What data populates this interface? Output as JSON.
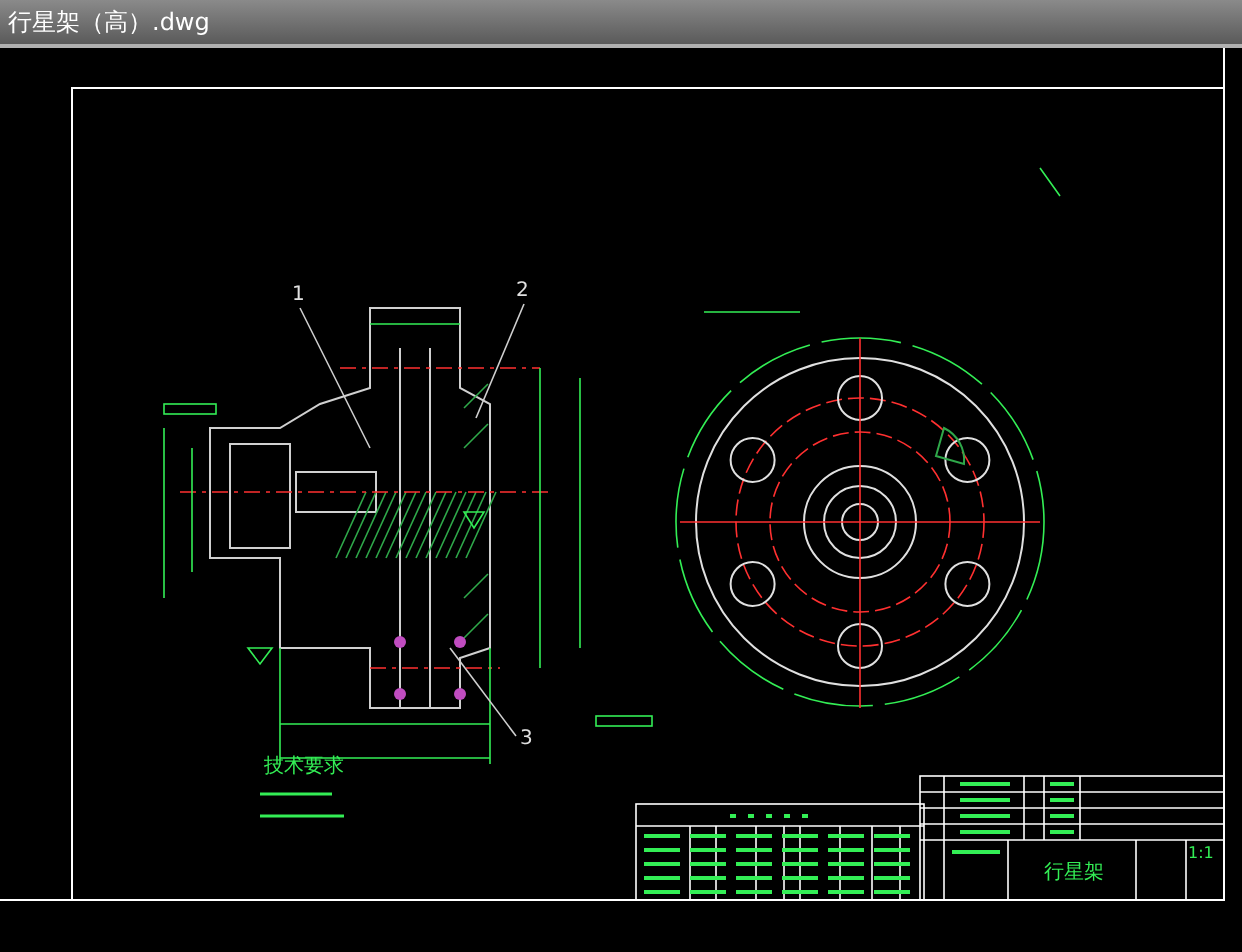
{
  "window": {
    "title": "行星架（高）.dwg"
  },
  "drawing": {
    "part_labels": [
      "1",
      "2",
      "3"
    ],
    "notes_heading": "技术要求",
    "title_block": {
      "part_name": "行星架",
      "scale": "1:1"
    }
  }
}
